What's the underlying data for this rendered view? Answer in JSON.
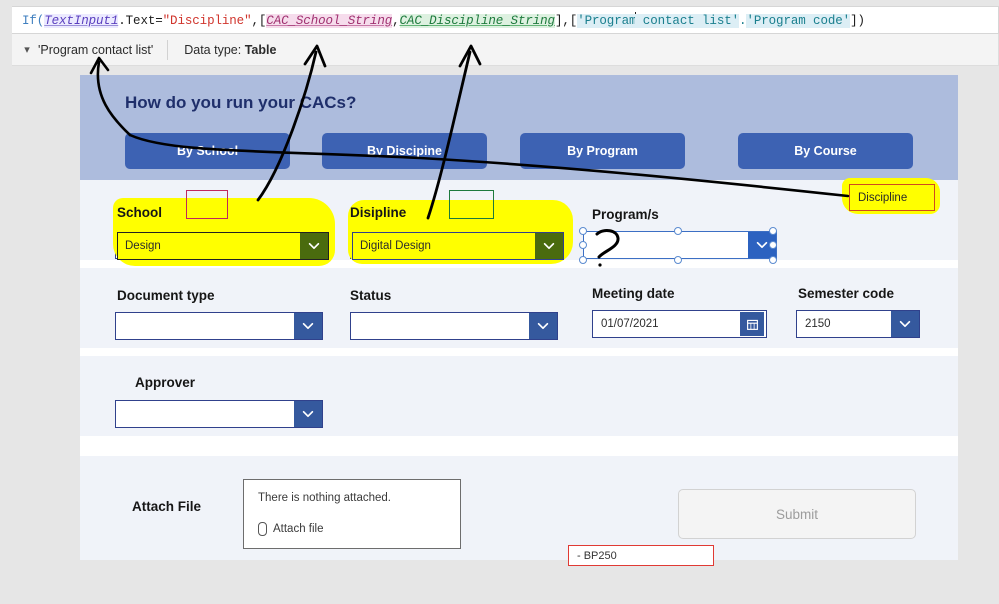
{
  "formula": {
    "tokens": [
      {
        "t": "If(",
        "c": "tk-fn"
      },
      {
        "t": "TextInput1",
        "c": "tk-ident"
      },
      {
        "t": ".Text=",
        "c": "tk-plain"
      },
      {
        "t": "\"Discipline\"",
        "c": "tk-str"
      },
      {
        "t": ",[",
        "c": "tk-plain"
      },
      {
        "t": "CAC_School_String",
        "c": "tk-var1"
      },
      {
        "t": ",",
        "c": "tk-plain"
      },
      {
        "t": "CAC_Discipline_String",
        "c": "tk-var2"
      },
      {
        "t": "],[",
        "c": "tk-plain"
      },
      {
        "t": "'Program",
        "c": "tk-src"
      },
      {
        "t": "CARET",
        "c": "caret"
      },
      {
        "t": " contact list'",
        "c": "tk-src"
      },
      {
        "t": ".",
        "c": "tk-src-p"
      },
      {
        "t": "'Program",
        "c": "tk-src"
      },
      {
        "t": " code'",
        "c": "tk-src"
      },
      {
        "t": "])",
        "c": "tk-plain"
      }
    ],
    "plain_text": "If(TextInput1.Text=\"Discipline\",[CAC_School_String,CAC_Discipline_String],['Program contact list'.'Program code'])"
  },
  "datatype_bar": {
    "chevron": "chevron-down",
    "source_name": "'Program contact list'",
    "datatype_label": "Data type:",
    "datatype_value": "Table"
  },
  "app": {
    "title": "How do you run your CACs?",
    "tabs": [
      {
        "label": "By School"
      },
      {
        "label": "By Discipine"
      },
      {
        "label": "By Program"
      },
      {
        "label": "By Course"
      }
    ],
    "fields": {
      "school": {
        "label": "School",
        "value": "Design"
      },
      "discipline": {
        "label": "Disipline",
        "value": "Digital Design"
      },
      "programs": {
        "label": "Program/s",
        "value": ""
      },
      "document_type": {
        "label": "Document type",
        "value": ""
      },
      "status": {
        "label": "Status",
        "value": ""
      },
      "meeting_date": {
        "label": "Meeting date",
        "value": "01/07/2021",
        "icon": "calendar-icon"
      },
      "semester_code": {
        "label": "Semester code",
        "value": "2150"
      },
      "approver": {
        "label": "Approver",
        "value": ""
      },
      "attach_file": {
        "label": "Attach File",
        "empty_text": "There is nothing attached.",
        "link_text": "Attach file",
        "icon": "paperclip-icon"
      }
    },
    "submit_label": "Submit"
  },
  "annotations": {
    "callout_discipline": "Discipline",
    "note_bp": "- BP250",
    "highlight_color": "#ffff00",
    "callout_border_color": "#d04a1f",
    "note_border_color": "#e03a34",
    "red_box_color": "#c0285c",
    "green_box_color": "#1d7a3c",
    "ink_color": "#000000"
  },
  "colors": {
    "header_band": "#adbcdd",
    "tab_blue": "#3d62b3",
    "form_row": "#f0f3f9",
    "control_border": "#30418c",
    "chevron_button": "#35599e",
    "title_navy": "#1f2f6b"
  }
}
